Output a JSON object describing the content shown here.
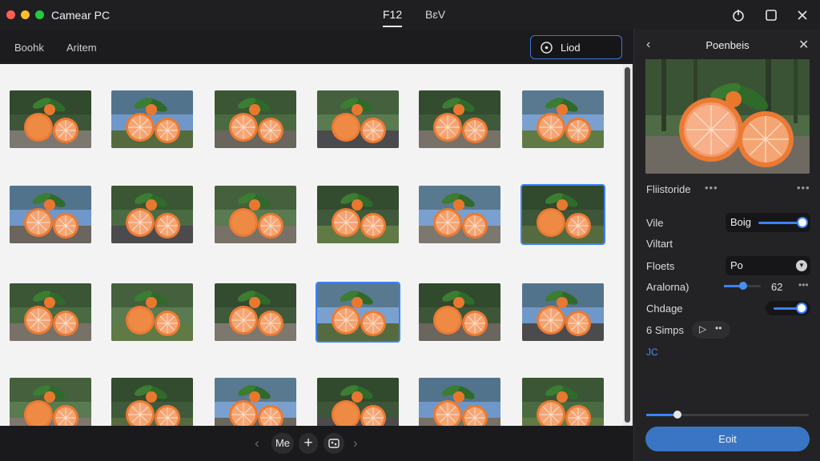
{
  "window": {
    "title": "Camear PC",
    "center_tabs": [
      "F12",
      "BɛV"
    ],
    "active_tab": "F12"
  },
  "toolbar": {
    "links": [
      "Boohk",
      "Aritem"
    ],
    "load_button": "Liod"
  },
  "grid": {
    "rows": 4,
    "columns": 6,
    "selected": [
      [
        1,
        5
      ],
      [
        2,
        3
      ]
    ]
  },
  "bottombar": {
    "page_label": "Me",
    "plus": "+",
    "image_icon": "◘"
  },
  "panel": {
    "title": "Poenbeis",
    "section_label": "Fliistoride",
    "rows": {
      "vile": "Vile",
      "viltart": "Viltart",
      "floets": "Floets",
      "araloma": "Aralorna)",
      "chdage": "Chdage",
      "steps": "6 Simps",
      "jc": "JC"
    },
    "vile_value": "Boig",
    "floets_value": "Po",
    "araloma_value": "62",
    "araloma_level": 0.45,
    "chdage_on": true,
    "bottom_slider_level": 0.18,
    "edit_button": "Eoit"
  },
  "colors": {
    "accent": "#3b82f6",
    "panel_bg": "#232325",
    "grid_bg": "#f3f3f3"
  }
}
